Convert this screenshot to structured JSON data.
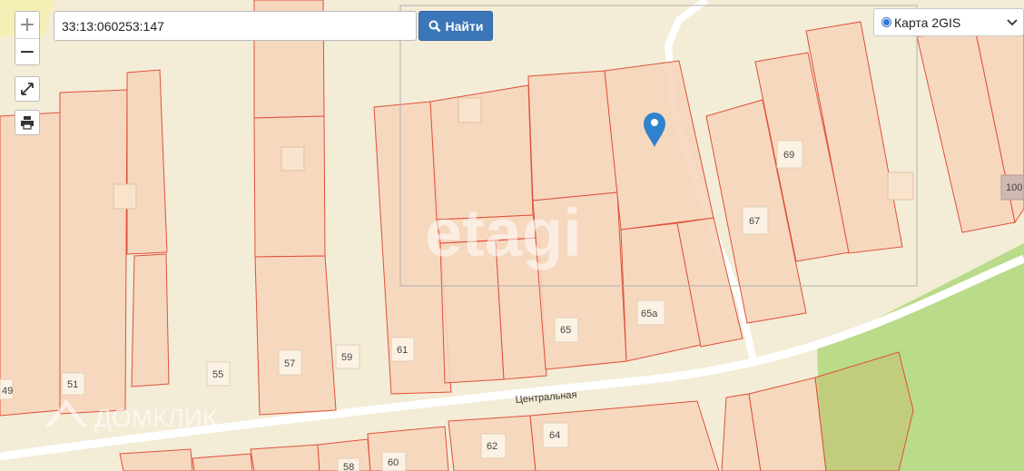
{
  "search": {
    "value": "33:13:060253:147",
    "button_label": "Найти"
  },
  "zoom": {
    "in_label": "+",
    "out_label": "−"
  },
  "layer": {
    "selected": "Карта 2GIS"
  },
  "map": {
    "street": "Центральная",
    "watermark_etagi": "etagi",
    "watermark_domclick": "ДОМКЛИК",
    "plots": [
      "49",
      "51",
      "55",
      "57",
      "59",
      "61",
      "65",
      "65а",
      "67",
      "69",
      "100",
      "62",
      "64",
      "58",
      "60"
    ],
    "colors": {
      "background": "#f3ecd6",
      "parcel_fill": "#f6d6bd",
      "parcel_stroke": "#e0503a",
      "road": "#ffffff",
      "park": "#b9db8a",
      "marker": "#2f83cc",
      "button": "#3a76b8"
    }
  }
}
